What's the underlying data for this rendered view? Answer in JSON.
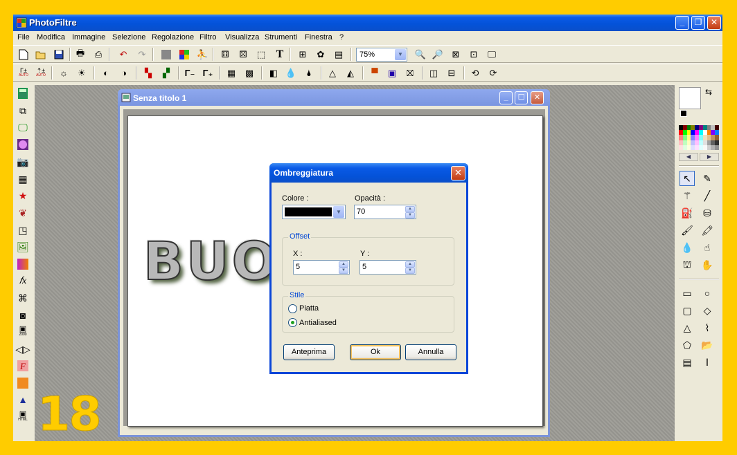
{
  "window": {
    "title": "PhotoFiltre"
  },
  "menu": [
    "File",
    "Modifica",
    "Immagine",
    "Selezione",
    "Regolazione",
    "Filtro",
    "Visualizza",
    "Strumenti",
    "Finestra",
    "?"
  ],
  "toolbar": {
    "zoom_value": "75%"
  },
  "toolbar2": {
    "gamma_minus_label": "AUTO",
    "gamma_plus_label": "AUTO"
  },
  "left_tools": {
    "html_label": "HTML",
    "save2000_label": "2000"
  },
  "document": {
    "title": "Senza titolo 1",
    "canvas_text": "BUO!              O!"
  },
  "dialog": {
    "title": "Ombreggiatura",
    "color_label": "Colore :",
    "color_value": "#000000",
    "opacity_label": "Opacità :",
    "opacity_value": "70",
    "offset_group": "Offset",
    "x_label": "X :",
    "x_value": "5",
    "y_label": "Y :",
    "y_value": "5",
    "style_group": "Stile",
    "style_options": [
      "Piatta",
      "Antialiased"
    ],
    "style_selected": "Antialiased",
    "preview_label": "Anteprima",
    "ok_label": "Ok",
    "cancel_label": "Annulla"
  },
  "badge": "18",
  "colors": {
    "frame": "#FFCC00",
    "titlebar": "#0452D8",
    "workspace": "#9C9B95"
  }
}
